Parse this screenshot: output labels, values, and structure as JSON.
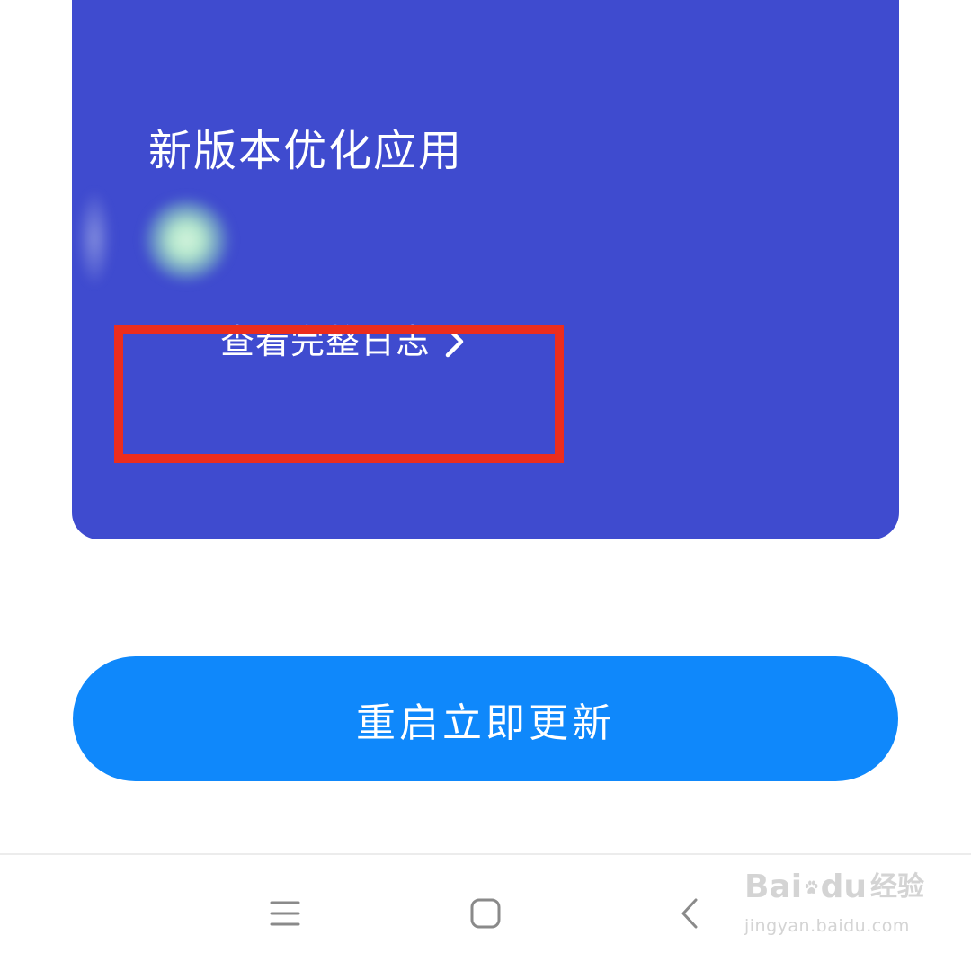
{
  "theme": {
    "card_color": "#3f4bcf",
    "button_color": "#0f88fb",
    "highlight_color": "#ec2d1d"
  },
  "update_card": {
    "headline": "新版本优化应用",
    "full_log_link": "查看完整日志",
    "full_log_icon": "chevron-right-icon",
    "graphic_icon": "blurred-app-icon"
  },
  "primary_action": {
    "label": "重启立即更新"
  },
  "navigation_bar": {
    "menu_icon": "menu-icon",
    "home_icon": "home-icon",
    "back_icon": "back-icon"
  },
  "watermark": {
    "brand_left": "Bai",
    "brand_right": "du",
    "brand_suffix": "经验",
    "url": "jingyan.baidu.com"
  }
}
